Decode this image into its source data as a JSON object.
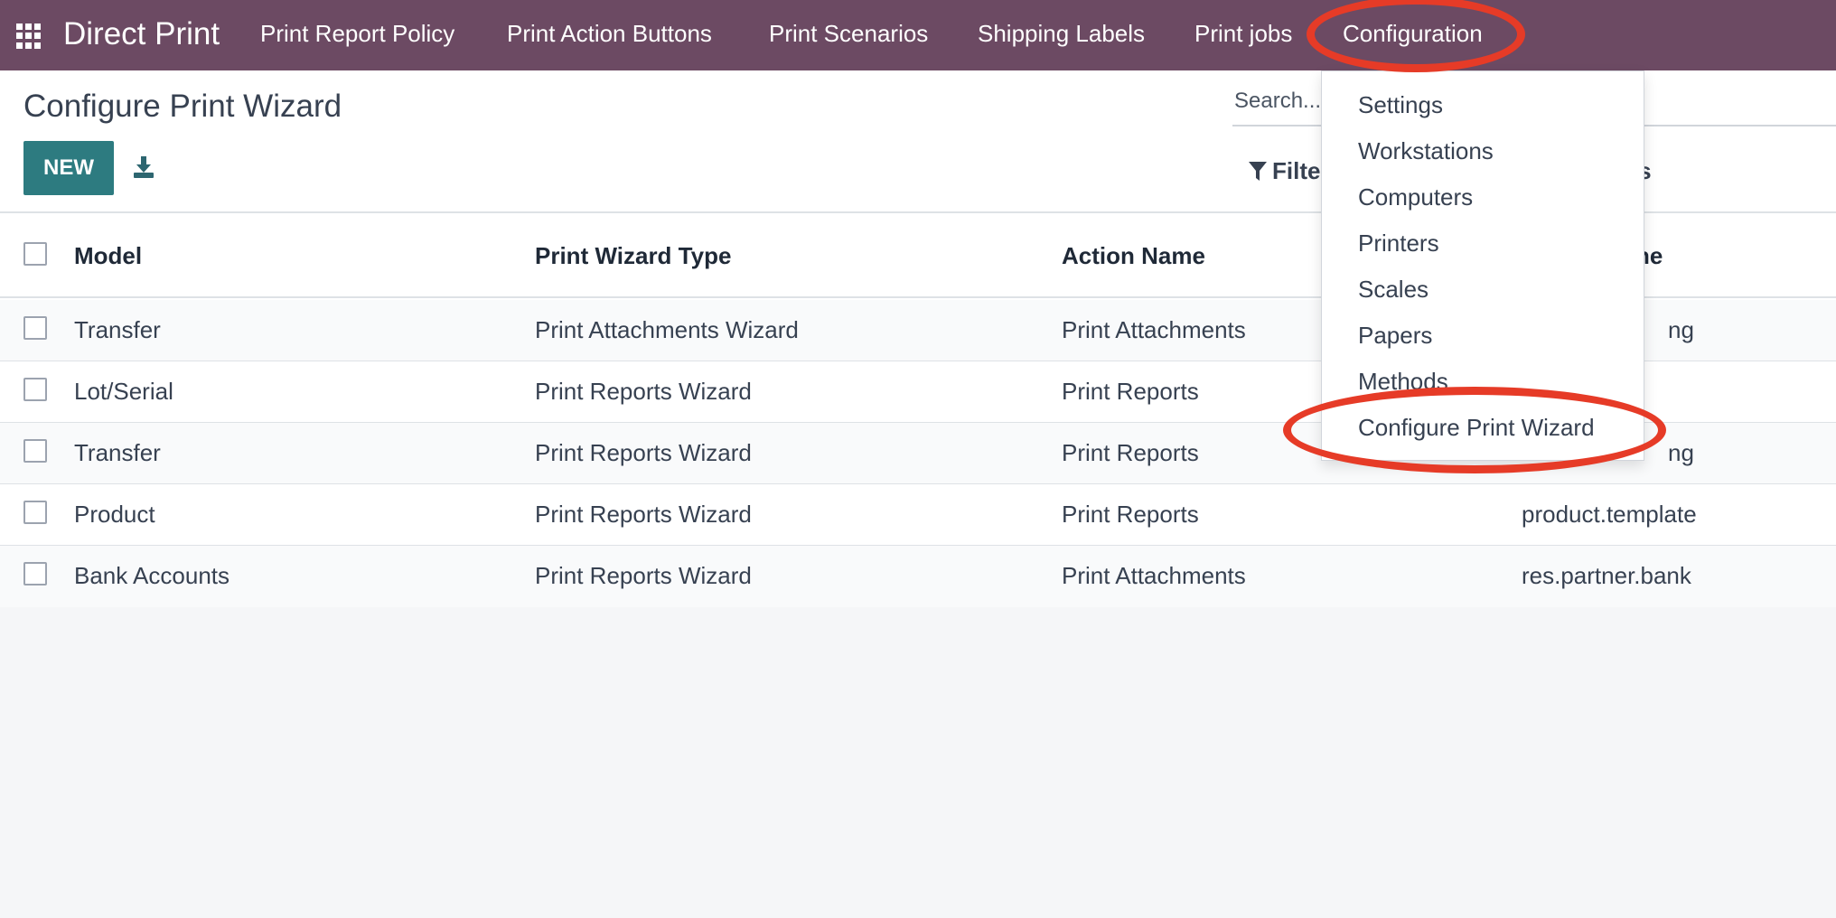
{
  "navbar": {
    "brand": "Direct Print",
    "menu": [
      "Print Report Policy",
      "Print Action Buttons",
      "Print Scenarios",
      "Shipping Labels",
      "Print jobs",
      "Configuration"
    ],
    "color": "#6c4a63"
  },
  "page": {
    "title": "Configure Print Wizard",
    "new_label": "NEW"
  },
  "search": {
    "placeholder": "Search...",
    "filters_label": "Filters",
    "favorites_label": "tes"
  },
  "table": {
    "headers": [
      "Model",
      "Print Wizard Type",
      "Action Name",
      "ne"
    ],
    "rows": [
      [
        "Transfer",
        "Print Attachments Wizard",
        "Print Attachments",
        "ng"
      ],
      [
        "Lot/Serial",
        "Print Reports Wizard",
        "Print Reports",
        ""
      ],
      [
        "Transfer",
        "Print Reports Wizard",
        "Print Reports",
        "ng"
      ],
      [
        "Product",
        "Print Reports Wizard",
        "Print Reports",
        "product.template"
      ],
      [
        "Bank Accounts",
        "Print Reports Wizard",
        "Print Attachments",
        "res.partner.bank"
      ]
    ]
  },
  "dropdown": {
    "items": [
      "Settings",
      "Workstations",
      "Computers",
      "Printers",
      "Scales",
      "Papers",
      "Methods",
      "Configure Print Wizard"
    ]
  },
  "colors": {
    "accent": "#2d7b80",
    "highlight": "#e63b27"
  }
}
